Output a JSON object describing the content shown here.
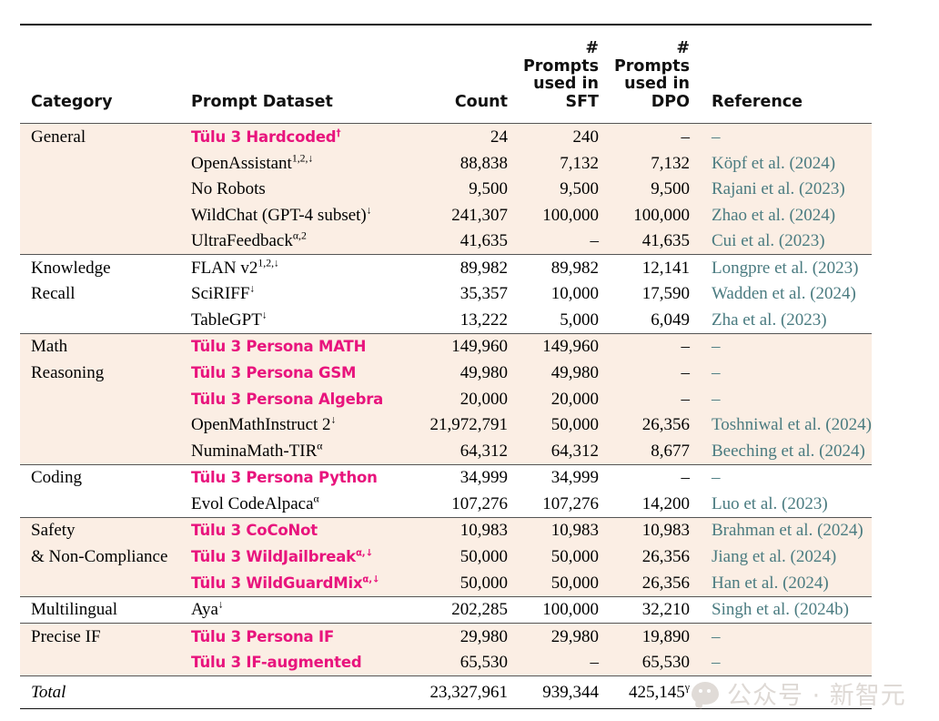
{
  "table": {
    "headers": {
      "category": "Category",
      "prompt_dataset": "Prompt Dataset",
      "count": "Count",
      "sft": "#\nPrompts\nused in\nSFT",
      "sft_lines": [
        "#",
        "Prompts",
        "used in",
        "SFT"
      ],
      "dpo_lines": [
        "#",
        "Prompts",
        "used in",
        "DPO"
      ],
      "reference": "Reference"
    },
    "colors": {
      "pink": "#e8147d",
      "reference_teal": "#4a7b80",
      "row_shade": "#fbeee4",
      "text": "#000000"
    },
    "groups": [
      {
        "shaded": true,
        "category_lines": [
          "General"
        ],
        "rows": [
          {
            "category": "General",
            "dataset": "Tülu 3 Hardcoded",
            "dataset_sup": "†",
            "pink": true,
            "count": "24",
            "sft": "240",
            "dpo": "–",
            "reference": "–"
          },
          {
            "category": "",
            "dataset": "OpenAssistant",
            "dataset_sup": "1,2,↓",
            "pink": false,
            "count": "88,838",
            "sft": "7,132",
            "dpo": "7,132",
            "reference": "Köpf et al. (2024)"
          },
          {
            "category": "",
            "dataset": "No Robots",
            "dataset_sup": "",
            "pink": false,
            "count": "9,500",
            "sft": "9,500",
            "dpo": "9,500",
            "reference": "Rajani et al. (2023)"
          },
          {
            "category": "",
            "dataset": "WildChat (GPT-4 subset)",
            "dataset_sup": "↓",
            "pink": false,
            "count": "241,307",
            "sft": "100,000",
            "dpo": "100,000",
            "reference": "Zhao et al. (2024)"
          },
          {
            "category": "",
            "dataset": "UltraFeedback",
            "dataset_sup": "α,2",
            "pink": false,
            "count": "41,635",
            "sft": "–",
            "dpo": "41,635",
            "reference": "Cui et al. (2023)"
          }
        ]
      },
      {
        "shaded": false,
        "category_lines": [
          "Knowledge",
          "Recall"
        ],
        "rows": [
          {
            "category": "Knowledge",
            "dataset": "FLAN v2",
            "dataset_sup": "1,2,↓",
            "pink": false,
            "count": "89,982",
            "sft": "89,982",
            "dpo": "12,141",
            "reference": "Longpre et al. (2023)"
          },
          {
            "category": "Recall",
            "dataset": "SciRIFF",
            "dataset_sup": "↓",
            "pink": false,
            "count": "35,357",
            "sft": "10,000",
            "dpo": "17,590",
            "reference": "Wadden et al. (2024)"
          },
          {
            "category": "",
            "dataset": "TableGPT",
            "dataset_sup": "↓",
            "pink": false,
            "count": "13,222",
            "sft": "5,000",
            "dpo": "6,049",
            "reference": "Zha et al. (2023)"
          }
        ]
      },
      {
        "shaded": true,
        "category_lines": [
          "Math",
          "Reasoning"
        ],
        "rows": [
          {
            "category": "Math",
            "dataset": "Tülu 3 Persona MATH",
            "dataset_sup": "",
            "pink": true,
            "count": "149,960",
            "sft": "149,960",
            "dpo": "–",
            "reference": "–"
          },
          {
            "category": "Reasoning",
            "dataset": "Tülu 3 Persona GSM",
            "dataset_sup": "",
            "pink": true,
            "count": "49,980",
            "sft": "49,980",
            "dpo": "–",
            "reference": "–"
          },
          {
            "category": "",
            "dataset": "Tülu 3 Persona Algebra",
            "dataset_sup": "",
            "pink": true,
            "count": "20,000",
            "sft": "20,000",
            "dpo": "–",
            "reference": "–"
          },
          {
            "category": "",
            "dataset": "OpenMathInstruct 2",
            "dataset_sup": "↓",
            "pink": false,
            "count": "21,972,791",
            "sft": "50,000",
            "dpo": "26,356",
            "reference": "Toshniwal et al. (2024)"
          },
          {
            "category": "",
            "dataset": "NuminaMath-TIR",
            "dataset_sup": "α",
            "pink": false,
            "count": "64,312",
            "sft": "64,312",
            "dpo": "8,677",
            "reference": "Beeching et al. (2024)"
          }
        ]
      },
      {
        "shaded": false,
        "category_lines": [
          "Coding"
        ],
        "rows": [
          {
            "category": "Coding",
            "dataset": "Tülu 3 Persona Python",
            "dataset_sup": "",
            "pink": true,
            "count": "34,999",
            "sft": "34,999",
            "dpo": "–",
            "reference": "–"
          },
          {
            "category": "",
            "dataset": "Evol CodeAlpaca",
            "dataset_sup": "α",
            "pink": false,
            "count": "107,276",
            "sft": "107,276",
            "dpo": "14,200",
            "reference": "Luo et al. (2023)"
          }
        ]
      },
      {
        "shaded": true,
        "category_lines": [
          "Safety",
          "& Non-Compliance"
        ],
        "rows": [
          {
            "category": "Safety",
            "dataset": "Tülu 3 CoCoNot",
            "dataset_sup": "",
            "pink": true,
            "count": "10,983",
            "sft": "10,983",
            "dpo": "10,983",
            "reference": "Brahman et al. (2024)"
          },
          {
            "category": "& Non-Compliance",
            "dataset": "Tülu 3 WildJailbreak",
            "dataset_sup": "α,↓",
            "pink": true,
            "count": "50,000",
            "sft": "50,000",
            "dpo": "26,356",
            "reference": "Jiang et al. (2024)"
          },
          {
            "category": "",
            "dataset": "Tülu 3 WildGuardMix",
            "dataset_sup": "α,↓",
            "pink": true,
            "count": "50,000",
            "sft": "50,000",
            "dpo": "26,356",
            "reference": "Han et al. (2024)"
          }
        ]
      },
      {
        "shaded": false,
        "category_lines": [
          "Multilingual"
        ],
        "rows": [
          {
            "category": "Multilingual",
            "dataset": "Aya",
            "dataset_sup": "↓",
            "pink": false,
            "count": "202,285",
            "sft": "100,000",
            "dpo": "32,210",
            "reference": "Singh et al. (2024b)"
          }
        ]
      },
      {
        "shaded": true,
        "category_lines": [
          "Precise IF"
        ],
        "rows": [
          {
            "category": "Precise IF",
            "dataset": "Tülu 3 Persona IF",
            "dataset_sup": "",
            "pink": true,
            "count": "29,980",
            "sft": "29,980",
            "dpo": "19,890",
            "reference": "–"
          },
          {
            "category": "",
            "dataset": "Tülu 3 IF-augmented",
            "dataset_sup": "",
            "pink": true,
            "count": "65,530",
            "sft": "–",
            "dpo": "65,530",
            "reference": "–"
          }
        ]
      }
    ],
    "total": {
      "label": "Total",
      "dataset": "",
      "count": "23,327,961",
      "sft": "939,344",
      "dpo": "425,145",
      "dpo_sup": "γ",
      "reference": ""
    }
  },
  "watermark": {
    "text": "公众号 · 新智元",
    "icon": "wechat-bubble-icon"
  }
}
